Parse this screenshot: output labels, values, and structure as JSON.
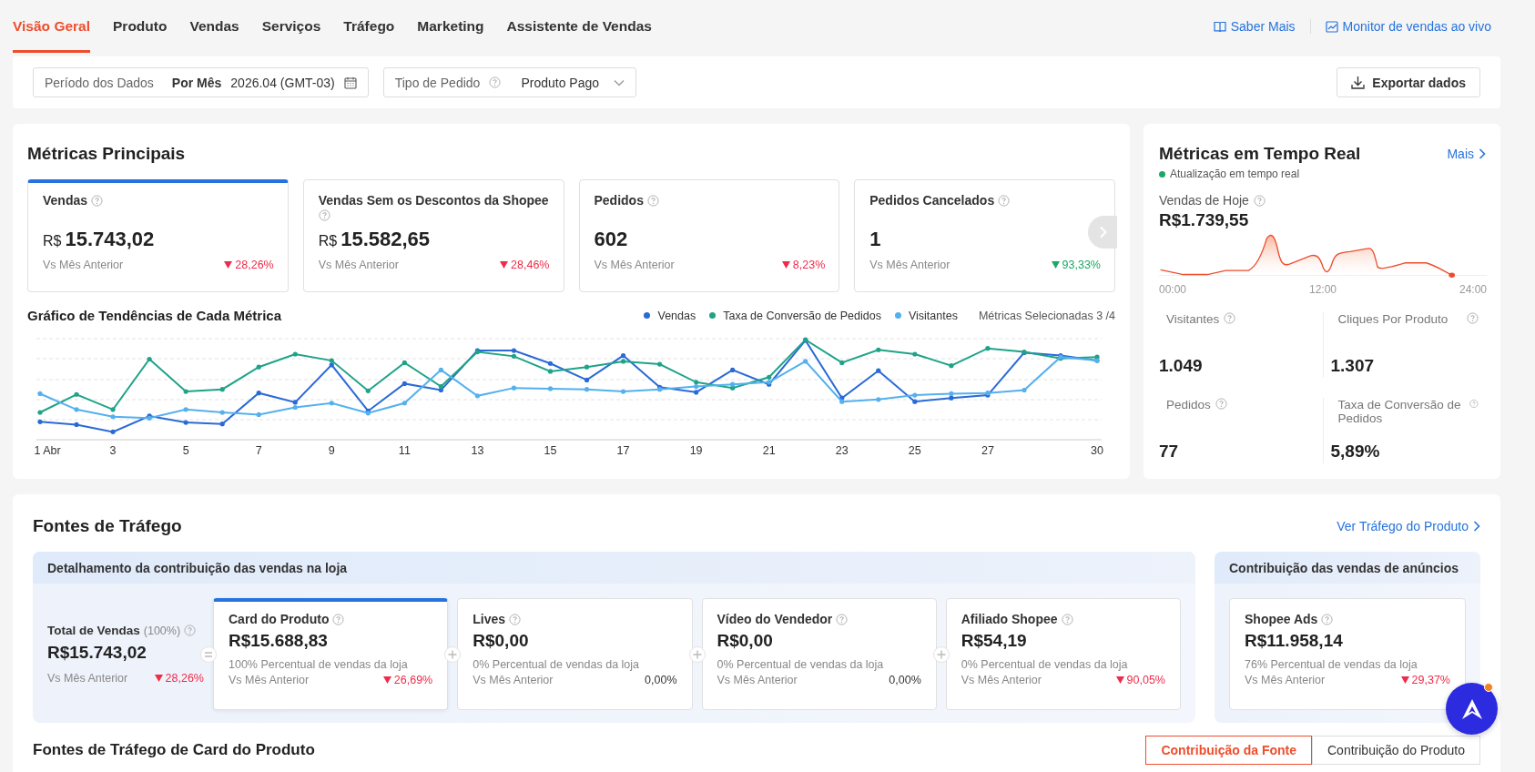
{
  "tabs": [
    {
      "label": "Visão Geral",
      "selected": true
    },
    {
      "label": "Produto",
      "selected": false
    },
    {
      "label": "Vendas",
      "selected": false
    },
    {
      "label": "Serviços",
      "selected": false
    },
    {
      "label": "Tráfego",
      "selected": false
    },
    {
      "label": "Marketing",
      "selected": false
    },
    {
      "label": "Assistente de Vendas",
      "selected": false
    }
  ],
  "header_links": [
    {
      "label": "Saber Mais",
      "kind": "book"
    },
    {
      "label": "Monitor de vendas ao vivo",
      "kind": "chart"
    }
  ],
  "filters": {
    "period_label": "Período dos Dados",
    "period_mode": "Por Mês",
    "period_value": "2026.04 (GMT-03)",
    "order_type_label": "Tipo de Pedido",
    "order_type_value": "Produto Pago",
    "export_button": "Exportar dados"
  },
  "main_metrics": {
    "title": "Métricas Principais",
    "cards": [
      {
        "label": "Vendas",
        "currency": "R$",
        "value": "15.743,02",
        "compare_label": "Vs Mês Anterior",
        "change": "28,26%",
        "kind": "down",
        "color": "#ee2c4a",
        "selected": true
      },
      {
        "label": "Vendas Sem os Descontos da Shopee",
        "currency": "R$",
        "value": "15.582,65",
        "compare_label": "Vs Mês Anterior",
        "change": "28,46%",
        "kind": "down",
        "color": "#ee2c4a",
        "selected": false
      },
      {
        "label": "Pedidos",
        "value": "602",
        "compare_label": "Vs Mês Anterior",
        "change": "8,23%",
        "kind": "down",
        "color": "#ee2c4a",
        "selected": false
      },
      {
        "label": "Pedidos Cancelados",
        "value": "1",
        "compare_label": "Vs Mês Anterior",
        "change": "93,33%",
        "kind": "down",
        "color": "#1aa867",
        "selected": false
      }
    ]
  },
  "trend_chart": {
    "title": "Gráfico de Tendências de Cada Métrica",
    "legend": [
      {
        "name": "Vendas",
        "color": "#2a6ad6"
      },
      {
        "name": "Taxa de Conversão de Pedidos",
        "color": "#1fa388"
      },
      {
        "name": "Visitantes",
        "color": "#54b0ee"
      }
    ],
    "selected_count": "Métricas Selecionadas 3 /4",
    "x_labels": [
      "1 Abr",
      "3",
      "5",
      "7",
      "9",
      "11",
      "13",
      "15",
      "17",
      "19",
      "21",
      "23",
      "25",
      "27",
      "30"
    ]
  },
  "realtime": {
    "title": "Métricas em Tempo Real",
    "more_link": "Mais",
    "status": "Atualização em tempo real",
    "sales_label": "Vendas de Hoje",
    "sales_value": "R$1.739,55",
    "axis_labels": [
      "00:00",
      "12:00",
      "24:00"
    ],
    "stats": [
      {
        "label": "Visitantes",
        "value": "1.049"
      },
      {
        "label": "Cliques Por Produto",
        "value": "1.307"
      },
      {
        "label": "Pedidos",
        "value": "77"
      },
      {
        "label": "Taxa de Conversão de Pedidos",
        "value": "5,89%"
      }
    ]
  },
  "traffic": {
    "title": "Fontes de Tráfego",
    "link": "Ver Tráfego do Produto",
    "store_panel": {
      "title": "Detalhamento da contribuição das vendas na loja",
      "total": {
        "label": "Total de Vendas",
        "share": "(100%)",
        "value": "R$15.743,02",
        "compare_label": "Vs Mês Anterior",
        "change": "28,26%",
        "kind": "down",
        "color": "#ee2c4a"
      },
      "sources": [
        {
          "label": "Card do Produto",
          "value": "R$15.688,83",
          "share_text": "100% Percentual de vendas da loja",
          "compare_label": "Vs Mês Anterior",
          "change": "26,69%",
          "kind": "down",
          "color": "#ee2c4a",
          "selected": true
        },
        {
          "label": "Lives",
          "value": "R$0,00",
          "share_text": "0% Percentual de vendas da loja",
          "compare_label": "Vs Mês Anterior",
          "change": "0,00%",
          "kind": "plain",
          "selected": false
        },
        {
          "label": "Vídeo do Vendedor",
          "value": "R$0,00",
          "share_text": "0% Percentual de vendas da loja",
          "compare_label": "Vs Mês Anterior",
          "change": "0,00%",
          "kind": "plain",
          "selected": false
        },
        {
          "label": "Afiliado Shopee",
          "value": "R$54,19",
          "share_text": "0% Percentual de vendas da loja",
          "compare_label": "Vs Mês Anterior",
          "change": "90,05%",
          "kind": "down",
          "color": "#ee2c4a",
          "selected": false
        }
      ]
    },
    "ads_panel": {
      "title": "Contribuição das vendas de anúncios",
      "sources": [
        {
          "label": "Shopee Ads",
          "value": "R$11.958,14",
          "share_text": "76% Percentual de vendas da loja",
          "compare_label": "Vs Mês Anterior",
          "change": "29,37%",
          "kind": "down",
          "color": "#ee2c4a",
          "selected": false
        }
      ]
    },
    "subsection_title": "Fontes de Tráfego de Card do Produto",
    "toggle": [
      {
        "label": "Contribuição da Fonte",
        "selected": true
      },
      {
        "label": "Contribuição do Produto",
        "selected": false
      }
    ]
  }
}
